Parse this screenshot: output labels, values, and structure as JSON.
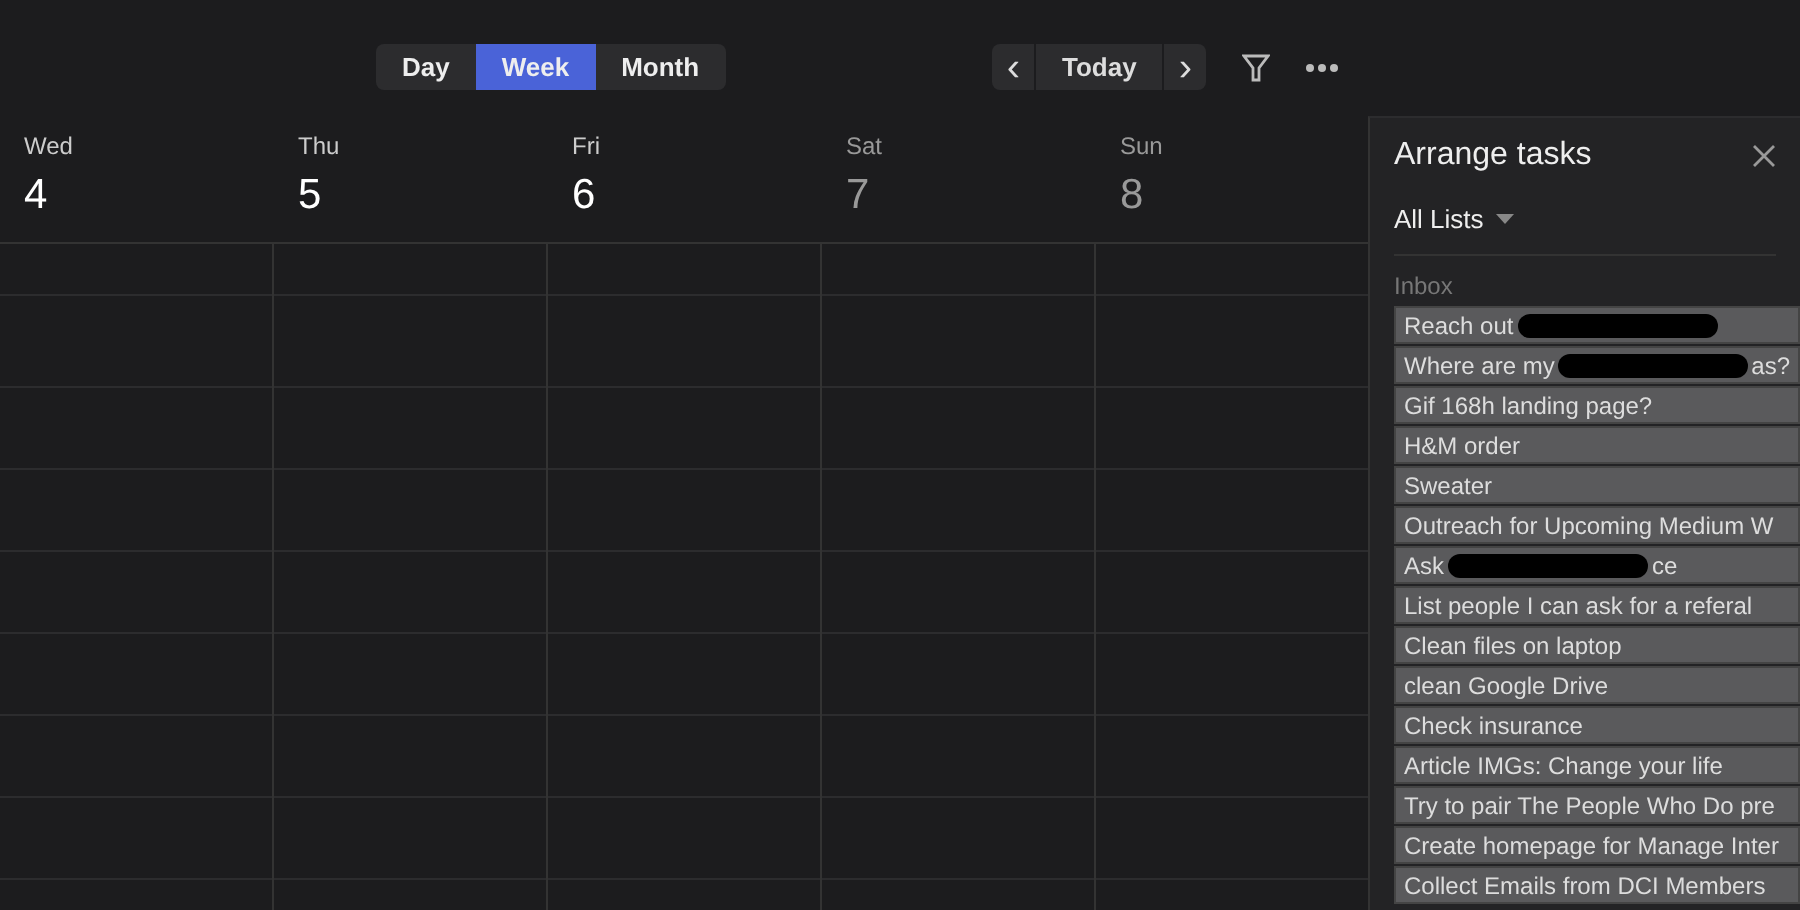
{
  "view_switcher": [
    {
      "label": "Day",
      "selected": false
    },
    {
      "label": "Week",
      "selected": true
    },
    {
      "label": "Month",
      "selected": false
    }
  ],
  "navigation": {
    "prev": "‹",
    "today": "Today",
    "next": "›"
  },
  "days": [
    {
      "weekday": "Wed",
      "date": "4",
      "weekend": false
    },
    {
      "weekday": "Thu",
      "date": "5",
      "weekend": false
    },
    {
      "weekday": "Fri",
      "date": "6",
      "weekend": false
    },
    {
      "weekday": "Sat",
      "date": "7",
      "weekend": true
    },
    {
      "weekday": "Sun",
      "date": "8",
      "weekend": true
    }
  ],
  "panel": {
    "title": "Arrange tasks",
    "list_filter": "All Lists",
    "section": "Inbox",
    "tasks": [
      {
        "text": "Reach out",
        "redacted": true
      },
      {
        "text": "Where are my",
        "redacted": true,
        "after": "as?"
      },
      {
        "text": "Gif 168h landing page?",
        "redacted": false
      },
      {
        "text": "H&M order",
        "redacted": false
      },
      {
        "text": "Sweater",
        "redacted": false
      },
      {
        "text": "Outreach for Upcoming Medium W",
        "redacted": false
      },
      {
        "text": "Ask",
        "redacted": true,
        "after": "ce"
      },
      {
        "text": "List people I can ask for a referal",
        "redacted": false
      },
      {
        "text": "Clean files on laptop",
        "redacted": false
      },
      {
        "text": "clean Google Drive",
        "redacted": false
      },
      {
        "text": "Check insurance",
        "redacted": false
      },
      {
        "text": "Article IMGs: Change your life",
        "redacted": false
      },
      {
        "text": "Try to pair The People Who Do pre",
        "redacted": false
      },
      {
        "text": "Create homepage for Manage Inter",
        "redacted": false
      },
      {
        "text": "Collect Emails from DCI Members",
        "redacted": false
      }
    ]
  }
}
